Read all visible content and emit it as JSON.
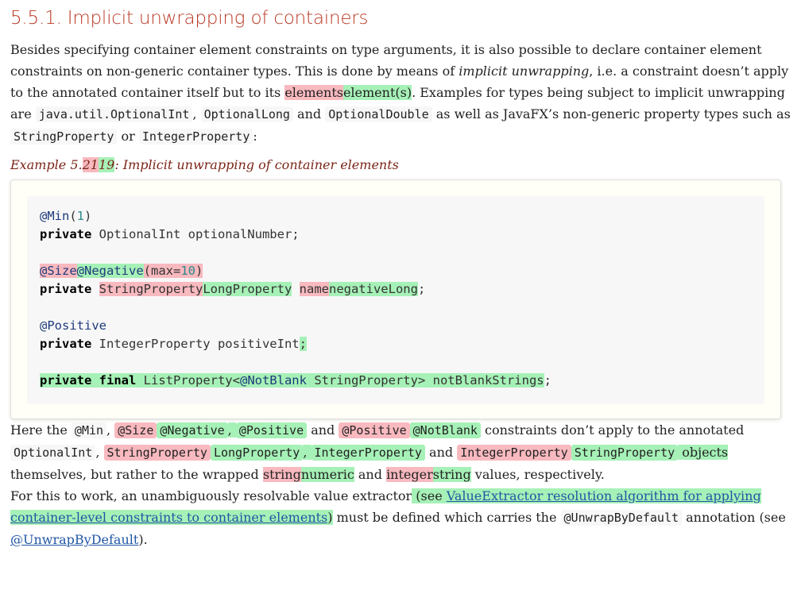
{
  "heading": "5.5.1. Implicit unwrapping of containers",
  "intro": {
    "t1": "Besides specifying container element constraints on type arguments, it is also possible to declare container element constraints on non-generic container types. This is done by means of ",
    "em1": "implicit unwrapping",
    "t2": ", i.e. a constraint doesn’t apply to the annotated container itself but to its ",
    "del1": "elements",
    "ins1": "element(s)",
    "t3": ". Examples for types being subject to implicit unwrapping are ",
    "c1": "java.util.OptionalInt",
    "t4": ", ",
    "c2": "OptionalLong",
    "t5": " and ",
    "c3": "OptionalDouble",
    "t6": " as well as JavaFX’s non-generic property types such as ",
    "c4": "StringProperty",
    "t7": " or ",
    "c5": "IntegerProperty",
    "t8": ":"
  },
  "example_caption": {
    "prefix": "Example 5.",
    "del": "21",
    "ins": "19",
    "suffix": ": Implicit unwrapping of container elements"
  },
  "code": {
    "l1_ann": "@Min",
    "l1_paren_open": "(",
    "l1_num": "1",
    "l1_paren_close": ")",
    "l2_kw": "private",
    "l2_rest": " OptionalInt optionalNumber;",
    "l3_del_ann": "@Size",
    "l3_ins_ann": "@Negative",
    "l3_del_args_open": "(max=",
    "l3_del_num": "10",
    "l3_del_args_close": ")",
    "l4_kw": "private",
    "l4_space": " ",
    "l4_del_type": "StringProperty",
    "l4_ins_type": "LongProperty",
    "l4_del_name": "name",
    "l4_ins_name": "negativeLong",
    "l4_end": ";",
    "l5_ann": "@Positive",
    "l6_kw": "private",
    "l6_rest": " IntegerProperty positiveInt",
    "l6_ins_end": ";",
    "l7_kw": "private final",
    "l7_mid": " ListProperty<",
    "l7_ann": "@NotBlank",
    "l7_rest": " StringProperty> notBlankStrings",
    "l7_end": ";"
  },
  "para2": {
    "t1": "Here the ",
    "c1": "@Min",
    "t2": ", ",
    "c2_del": "@Size",
    "c2_ins": "@Negative",
    "t3_ins": ", ",
    "c3_ins": "@Positive",
    "t4": " and ",
    "c4_del": "@Positive",
    "c4_ins": "@NotBlank",
    "t5": " constraints don’t apply to the annotated ",
    "c5": "OptionalInt",
    "t6": ", ",
    "c6_del": "StringProperty",
    "c6_ins": "LongProperty",
    "t7_ins": ", ",
    "c7_ins": "IntegerProperty",
    "t8": " and ",
    "c8_del": "IntegerProperty",
    "c8_ins": "StringProperty",
    "t9_ins": " objects",
    "t10": " themselves, but rather to the wrapped ",
    "w1_del": "string",
    "w1_ins": "numeric",
    "t11": " and ",
    "w2_del": "integer",
    "w2_ins": "string",
    "t12": " values, respectively."
  },
  "para3": {
    "t1": "For this to work, an unambiguously resolvable value extractor",
    "ins_open": " (see ",
    "link1": "ValueExtractor resolution algorithm for applying container-level constraints to container elements",
    "ins_close": ")",
    "t2": " must be defined which carries the ",
    "c1": "@UnwrapByDefault",
    "t3": " annotation (see ",
    "link2": "@UnwrapByDefault",
    "t4": ")."
  },
  "colors": {
    "heading": "#ba3925",
    "caption": "#7a2518",
    "deleted": "#f8b9bf",
    "inserted": "#a6f1b7",
    "link": "#2156a5"
  }
}
